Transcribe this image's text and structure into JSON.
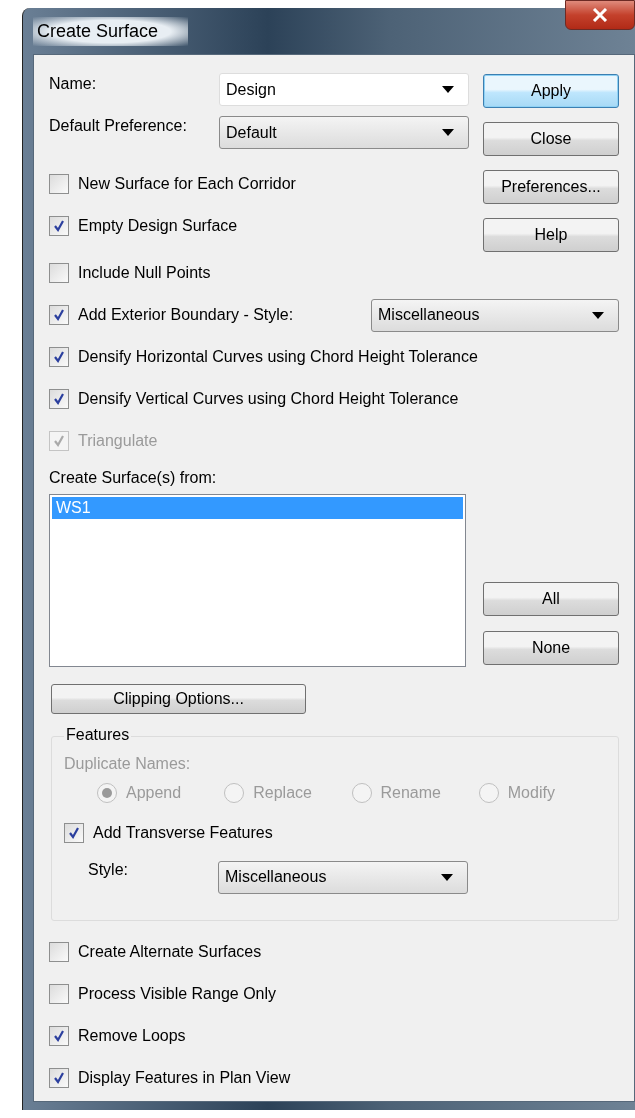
{
  "window": {
    "title": "Create Surface"
  },
  "name": {
    "label": "Name:",
    "value": "Design"
  },
  "default_preference": {
    "label": "Default Preference:",
    "value": "Default"
  },
  "buttons": [
    {
      "label": "Apply",
      "focused": true
    },
    {
      "label": "Close",
      "focused": false
    },
    {
      "label": "Preferences...",
      "focused": false
    },
    {
      "label": "Help",
      "focused": false
    }
  ],
  "options_top": [
    {
      "kind": "check",
      "label": "New Surface for Each Corridor",
      "checked": false,
      "disabled": false
    },
    {
      "kind": "check",
      "label": "Empty Design Surface",
      "checked": true,
      "disabled": false
    }
  ],
  "options": [
    {
      "kind": "check",
      "label": "Include Null Points",
      "checked": false,
      "disabled": false
    },
    {
      "kind": "check_style",
      "label": "Add Exterior Boundary - Style:",
      "checked": true,
      "disabled": false,
      "style": "Miscellaneous"
    },
    {
      "kind": "check",
      "label": "Densify Horizontal Curves using Chord Height Tolerance",
      "checked": true,
      "disabled": false
    },
    {
      "kind": "check",
      "label": "Densify Vertical Curves using Chord Height Tolerance",
      "checked": true,
      "disabled": false
    },
    {
      "kind": "check",
      "label": "Triangulate",
      "checked": true,
      "disabled": true
    }
  ],
  "source": {
    "label": "Create Surface(s) from:",
    "items": [
      {
        "label": "WS1",
        "selected": true
      }
    ]
  },
  "list_buttons": [
    "All",
    "None"
  ],
  "clipping_button": "Clipping Options...",
  "features": {
    "title": "Features",
    "duplicate_names": {
      "label": "Duplicate Names:",
      "disabled": true,
      "options": [
        {
          "label": "Append",
          "selected": true
        },
        {
          "label": "Replace",
          "selected": false
        },
        {
          "label": "Rename",
          "selected": false
        },
        {
          "label": "Modify",
          "selected": false
        }
      ]
    },
    "add_transverse": {
      "label": "Add Transverse Features",
      "checked": true
    },
    "style": {
      "label": "Style:",
      "value": "Miscellaneous"
    }
  },
  "options_bottom": [
    {
      "kind": "check",
      "label": "Create Alternate Surfaces",
      "checked": false,
      "disabled": false
    },
    {
      "kind": "check",
      "label": "Process Visible Range Only",
      "checked": false,
      "disabled": false
    },
    {
      "kind": "check",
      "label": "Remove Loops",
      "checked": true,
      "disabled": false
    },
    {
      "kind": "check",
      "label": "Display Features in Plan View",
      "checked": true,
      "disabled": false
    }
  ]
}
